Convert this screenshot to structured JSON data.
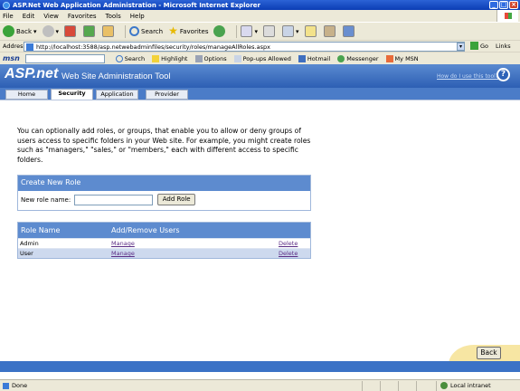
{
  "window": {
    "title": "ASP.Net Web Application Administration - Microsoft Internet Explorer",
    "buttons": [
      "_",
      "□",
      "×"
    ]
  },
  "menu": [
    "File",
    "Edit",
    "View",
    "Favorites",
    "Tools",
    "Help"
  ],
  "toolbar": {
    "back_label": "Back",
    "search_label": "Search",
    "favorites_label": "Favorites"
  },
  "address": {
    "label": "Address",
    "url": "http://localhost:3588/asp.netwebadminfiles/security/roles/manageAllRoles.aspx",
    "go_label": "Go",
    "links_label": "Links"
  },
  "msn_bar": {
    "logo": "msn",
    "search_label": "Search",
    "highlight_label": "Highlight",
    "options_label": "Options",
    "popups_label": "Pop-ups Allowed",
    "hotmail_label": "Hotmail",
    "messenger_label": "Messenger",
    "mymsn_label": "My MSN"
  },
  "header": {
    "logo": "ASP.net",
    "title": "Web Site Administration Tool",
    "help_link": "How do I use this tool?",
    "help_icon": "?"
  },
  "tabs": [
    {
      "label": "Home",
      "active": false
    },
    {
      "label": "Security",
      "active": true
    },
    {
      "label": "Application",
      "active": false
    },
    {
      "label": "Provider",
      "active": false
    }
  ],
  "intro": "You can optionally add roles, or groups, that enable you to allow or deny groups of users access to specific folders in your Web site. For example, you might create roles such as \"managers,\" \"sales,\" or \"members,\" each with different access to specific folders.",
  "create_role": {
    "heading": "Create New Role",
    "field_label": "New role name:",
    "field_value": "",
    "button_label": "Add Role"
  },
  "roles_table": {
    "col_role": "Role Name",
    "col_users": "Add/Remove Users",
    "rows": [
      {
        "name": "Admin",
        "manage": "Manage",
        "delete": "Delete"
      },
      {
        "name": "User",
        "manage": "Manage",
        "delete": "Delete"
      }
    ]
  },
  "back_button": "Back",
  "status": {
    "text": "Done",
    "zone": "Local intranet"
  },
  "colors": {
    "header_blue": "#2d5fb4",
    "panel_head": "#5d8bcf",
    "alt_row": "#cdd9ee",
    "link_visited": "#5b2c84"
  }
}
